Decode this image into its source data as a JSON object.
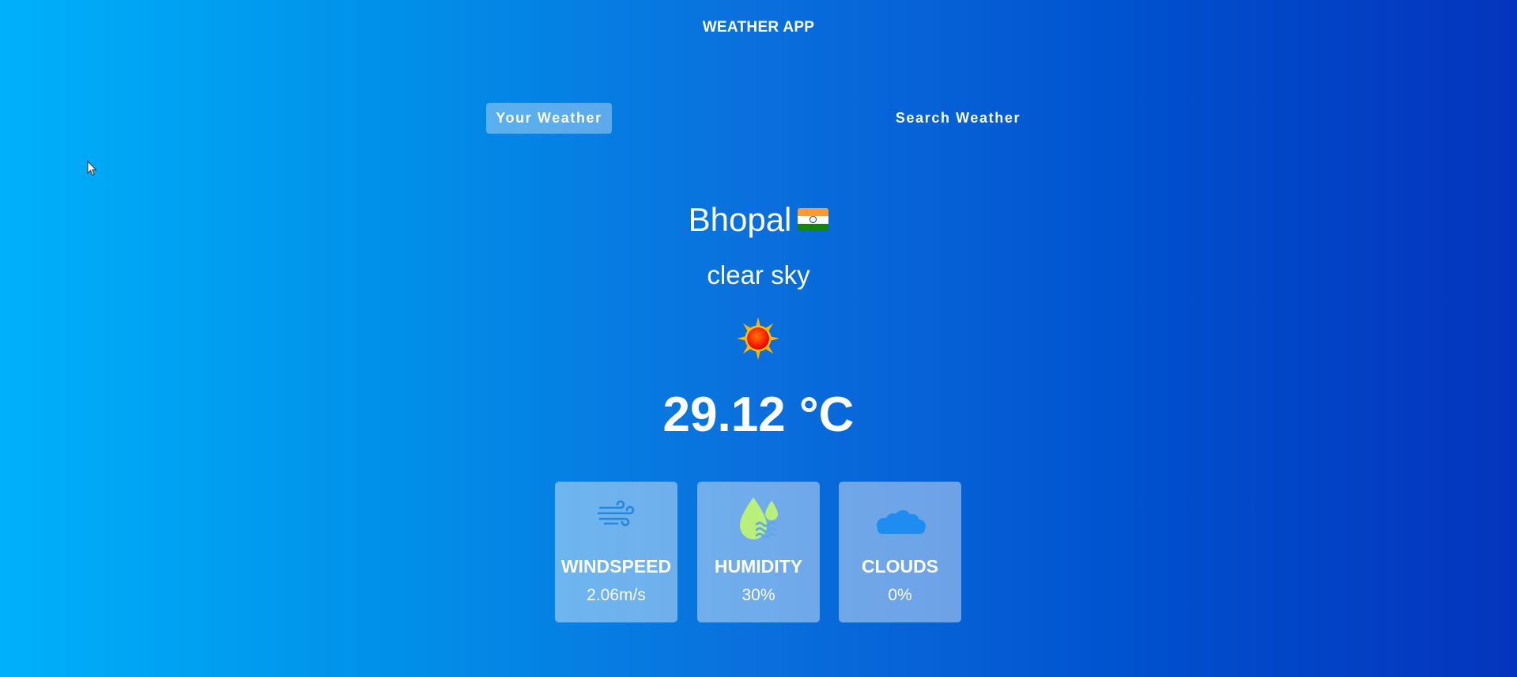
{
  "app": {
    "title": "WEATHER APP"
  },
  "tabs": [
    {
      "label": "Your Weather",
      "active": true
    },
    {
      "label": "Search Weather",
      "active": false
    }
  ],
  "location": {
    "city": "Bhopal",
    "country_flag_icon": "india-flag-icon"
  },
  "weather": {
    "description": "clear sky",
    "icon": "sun-icon",
    "temperature": "29.12 °C"
  },
  "details": [
    {
      "label": "WINDSPEED",
      "value": "2.06m/s",
      "icon": "wind-icon"
    },
    {
      "label": "HUMIDITY",
      "value": "30%",
      "icon": "humidity-icon"
    },
    {
      "label": "CLOUDS",
      "value": "0%",
      "icon": "cloud-icon"
    }
  ],
  "colors": {
    "background_start": "#00b0fb",
    "background_end": "#0434bd",
    "wind_icon": "#2a86d8",
    "humidity_icon": "#b8f07a",
    "cloud_icon": "#1e8cf0"
  }
}
